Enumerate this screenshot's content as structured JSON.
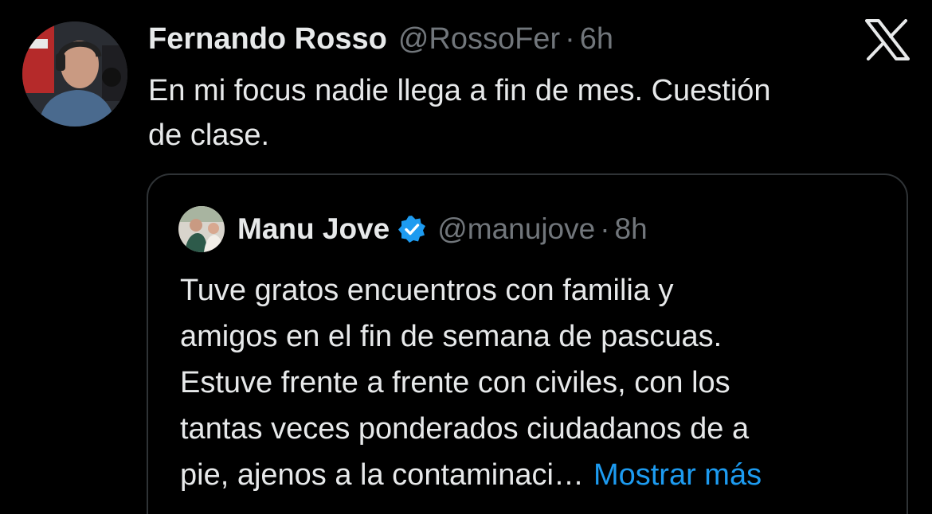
{
  "tweet": {
    "author_name": "Fernando Rosso",
    "handle": "@RossoFer",
    "separator": "·",
    "time": "6h",
    "text_lines": [
      "En mi focus nadie llega a fin de mes. Cuestión",
      "de clase."
    ]
  },
  "quoted": {
    "author_name": "Manu Jove",
    "handle": "@manujove",
    "separator": "·",
    "time": "8h",
    "text_lines": [
      "Tuve gratos encuentros con familia y",
      "amigos en el fin de semana de pascuas.",
      "Estuve frente a frente con civiles, con los",
      "tantas veces ponderados ciudadanos de a",
      "pie, ajenos a la contaminaci…"
    ],
    "show_more_label": "Mostrar más"
  },
  "icons": {
    "platform_logo": "x-logo-icon",
    "verified_badge": "verified-badge-icon"
  },
  "colors": {
    "background": "#000000",
    "text": "#e7e9ea",
    "muted": "#71767b",
    "link": "#1d9bf0",
    "border": "#2f3336"
  }
}
